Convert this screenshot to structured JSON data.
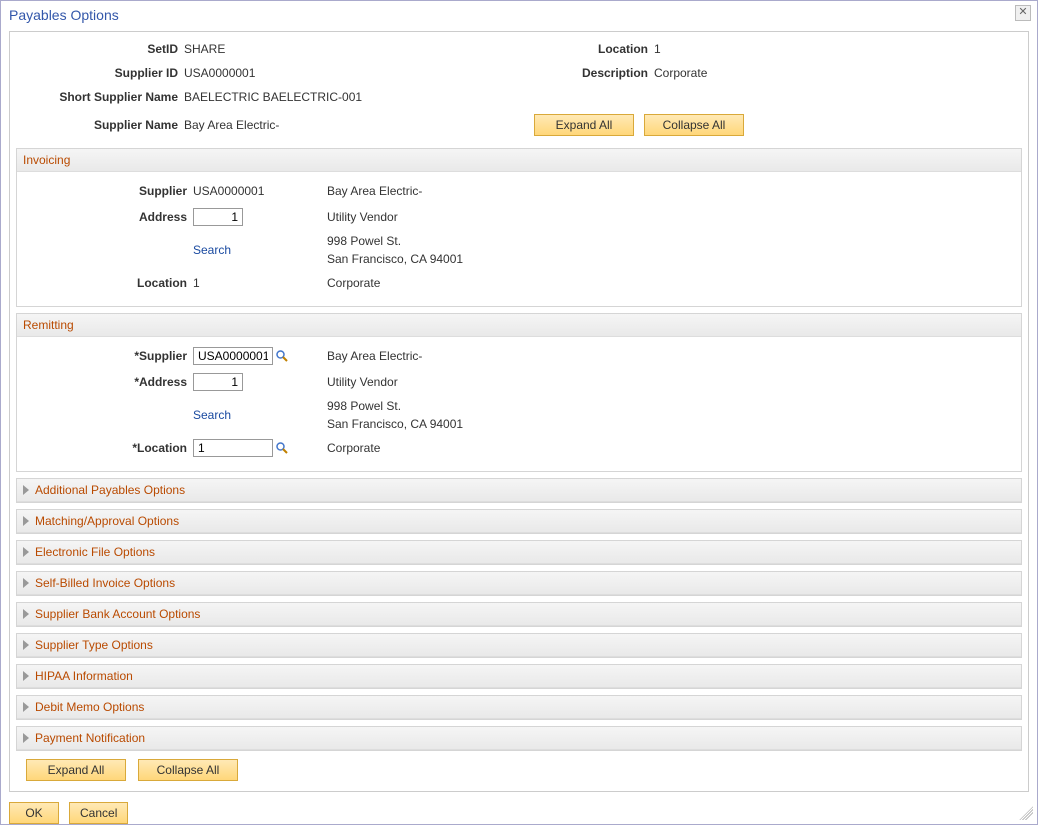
{
  "title": "Payables Options",
  "header": {
    "setid_label": "SetID",
    "setid": "SHARE",
    "location_label": "Location",
    "location": "1",
    "supplier_id_label": "Supplier ID",
    "supplier_id": "USA0000001",
    "description_label": "Description",
    "description": "Corporate",
    "short_name_label": "Short Supplier Name",
    "short_name": "BAELECTRIC   BAELECTRIC-001",
    "supplier_name_label": "Supplier Name",
    "supplier_name": "Bay Area Electric-"
  },
  "buttons": {
    "expand_all": "Expand All",
    "collapse_all": "Collapse All",
    "ok": "OK",
    "cancel": "Cancel"
  },
  "invoicing": {
    "title": "Invoicing",
    "supplier_label": "Supplier",
    "supplier_value": "USA0000001",
    "supplier_name": "Bay Area Electric-",
    "address_label": "Address",
    "address_value": "1",
    "search": "Search",
    "addr_line1": "Utility Vendor",
    "addr_line2": "998 Powel St.",
    "addr_line3": "San Francisco, CA  94001",
    "location_label": "Location",
    "location_value": "1",
    "location_desc": "Corporate"
  },
  "remitting": {
    "title": "Remitting",
    "supplier_label": "*Supplier",
    "supplier_value": "USA0000001",
    "supplier_name": "Bay Area Electric-",
    "address_label": "*Address",
    "address_value": "1",
    "search": "Search",
    "addr_line1": "Utility Vendor",
    "addr_line2": "998 Powel St.",
    "addr_line3": "San Francisco, CA  94001",
    "location_label": "*Location",
    "location_value": "1",
    "location_desc": "Corporate"
  },
  "collapsed_sections": [
    "Additional Payables Options",
    "Matching/Approval Options",
    "Electronic File Options",
    "Self-Billed Invoice Options",
    "Supplier Bank Account Options",
    "Supplier Type Options",
    "HIPAA Information",
    "Debit Memo Options",
    "Payment Notification"
  ]
}
